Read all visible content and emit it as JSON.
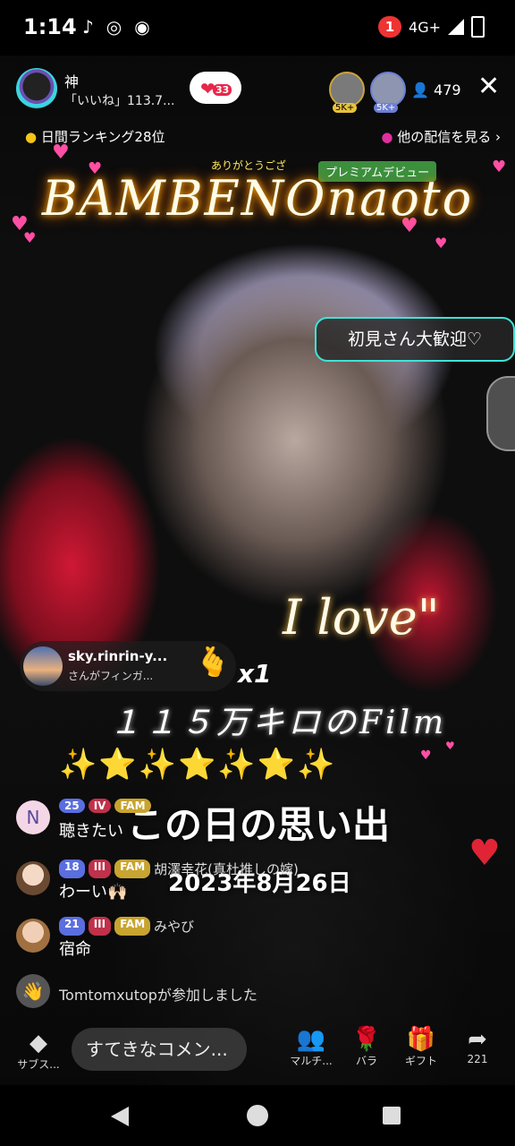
{
  "status_bar": {
    "time": "1:14",
    "notification_count": "1",
    "network": "4G+"
  },
  "host": {
    "name": "神",
    "likes_text": "「いいね」113.7...",
    "like_badge": "33"
  },
  "viewers": {
    "badge_a": "5K+",
    "badge_b": "5K+",
    "count": "479"
  },
  "ranking": "日間ランキング28位",
  "other_streams": "他の配信を見る ›",
  "overlay": {
    "title": "BAMBENOnaoto",
    "thanks": "ありがとうござ",
    "premium": "プレミアムデビュー",
    "welcome_bubble": "初見さん大歓迎♡",
    "i_love": "I love\"",
    "film": "１１５万キロのFilm",
    "memory": "この日の思い出",
    "date": "2023年8月26日"
  },
  "gift": {
    "user": "sky.rinrin-y...",
    "sub": "さんがフィンガ...",
    "count": "x1"
  },
  "comments": [
    {
      "level": "25",
      "heart": "IV",
      "fam": "FAM",
      "nick": "",
      "message": "聴きたい"
    },
    {
      "level": "18",
      "heart": "III",
      "fam": "FAM",
      "nick": "胡澤幸花(真杜推しの嫁)",
      "message": "わーい🙌🏻"
    },
    {
      "level": "21",
      "heart": "III",
      "fam": "FAM",
      "nick": "みやび",
      "message": "宿命"
    }
  ],
  "join_message": "Tomtomxutopが参加しました",
  "bottom_bar": {
    "subscribe": "サブス...",
    "comment_placeholder": "すてきなコメン...",
    "multi": "マルチ...",
    "rose": "バラ",
    "gift": "ギフト",
    "share_count": "221"
  }
}
